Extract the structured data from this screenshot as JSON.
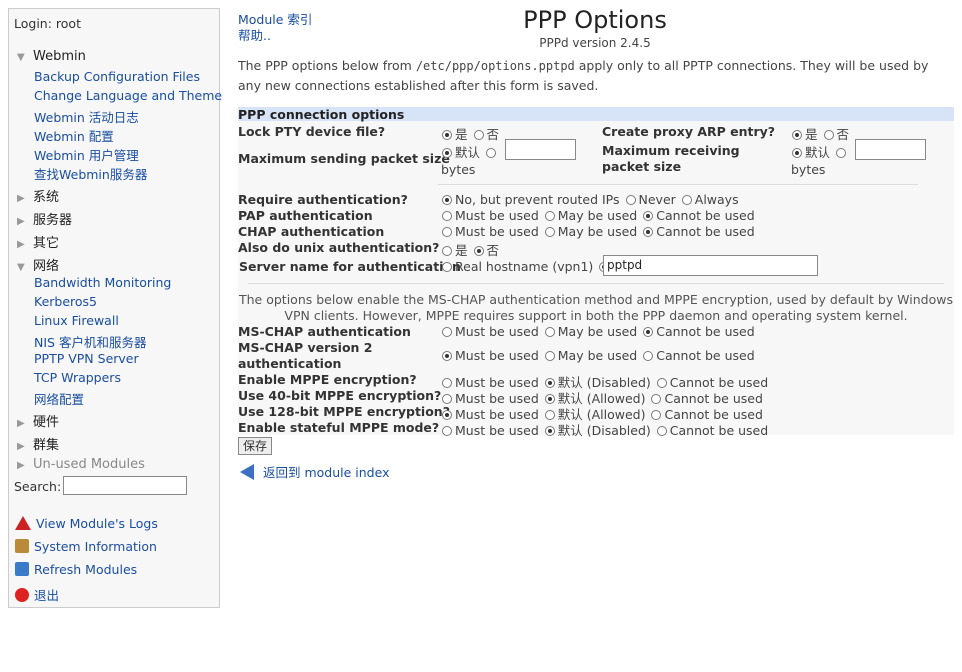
{
  "sidebar": {
    "login": "Login: root",
    "categories": {
      "webmin": "Webmin",
      "system": "系统",
      "servers": "服务器",
      "other": "其它",
      "network": "网络",
      "hardware": "硬件",
      "cluster": "群集",
      "unused": "Un-used Modules"
    },
    "webmin_items": [
      "Backup Configuration Files",
      "Change Language and Theme",
      "Webmin 活动日志",
      "Webmin 配置",
      "Webmin 用户管理",
      "查找Webmin服务器"
    ],
    "network_items": [
      "Bandwidth Monitoring",
      "Kerberos5",
      "Linux Firewall",
      "NIS 客户机和服务器",
      "PPTP VPN Server",
      "TCP Wrappers",
      "网络配置"
    ],
    "search_label": "Search:",
    "footer": [
      "View Module's Logs",
      "System Information",
      "Refresh Modules",
      "退出"
    ]
  },
  "header": {
    "module_index": "Module 索引",
    "help": "帮助..",
    "title": "PPP Options",
    "subtitle": "PPPd version 2.4.5"
  },
  "intro": {
    "before": "The PPP options below from ",
    "path": "/etc/ppp/options.pptpd",
    "after": " apply only to all PPTP connections. They will be used by any new connections established after this form is saved."
  },
  "form": {
    "section_title": "PPP connection options",
    "lock_pty": {
      "label": "Lock PTY device file?",
      "yes": "是",
      "no": "否"
    },
    "proxy_arp": {
      "label": "Create proxy ARP entry?",
      "yes": "是",
      "no": "否"
    },
    "max_send": {
      "label": "Maximum sending packet size",
      "default": "默认",
      "unit": "bytes",
      "value": ""
    },
    "max_recv": {
      "label": "Maximum receiving packet size",
      "default": "默认",
      "unit": "bytes",
      "value": ""
    },
    "require_auth": {
      "label": "Require authentication?",
      "opt1": "No, but prevent routed IPs",
      "opt2": "Never",
      "opt3": "Always"
    },
    "pap": {
      "label": "PAP authentication",
      "opt1": "Must be used",
      "opt2": "May be used",
      "opt3": "Cannot be used"
    },
    "chap": {
      "label": "CHAP authentication",
      "opt1": "Must be used",
      "opt2": "May be used",
      "opt3": "Cannot be used"
    },
    "unix_auth": {
      "label": "Also do unix authentication?",
      "yes": "是",
      "no": "否"
    },
    "server_name": {
      "label": "Server name for authentication",
      "opt1": "Real hostname (vpn1)",
      "value": "pptpd"
    },
    "ms_note": "The options below enable the MS-CHAP authentication method and MPPE encryption, used by default by Windows VPN clients. However, MPPE requires support in both the PPP daemon and operating system kernel.",
    "mschap": {
      "label": "MS-CHAP authentication",
      "opt1": "Must be used",
      "opt2": "May be used",
      "opt3": "Cannot be used"
    },
    "mschap2": {
      "label": "MS-CHAP version 2 authentication",
      "opt1": "Must be used",
      "opt2": "May be used",
      "opt3": "Cannot be used"
    },
    "mppe": {
      "label": "Enable MPPE encryption?",
      "opt1": "Must be used",
      "opt2": "默认 (Disabled)",
      "opt3": "Cannot be used"
    },
    "mppe40": {
      "label": "Use 40-bit MPPE encryption?",
      "opt1": "Must be used",
      "opt2": "默认 (Allowed)",
      "opt3": "Cannot be used"
    },
    "mppe128": {
      "label": "Use 128-bit MPPE encryption?",
      "opt1": "Must be used",
      "opt2": "默认 (Allowed)",
      "opt3": "Cannot be used"
    },
    "mppe_stateful": {
      "label": "Enable stateful MPPE mode?",
      "opt1": "Must be used",
      "opt2": "默认 (Disabled)",
      "opt3": "Cannot be used"
    },
    "save": "保存"
  },
  "back_link": "返回到 module index"
}
